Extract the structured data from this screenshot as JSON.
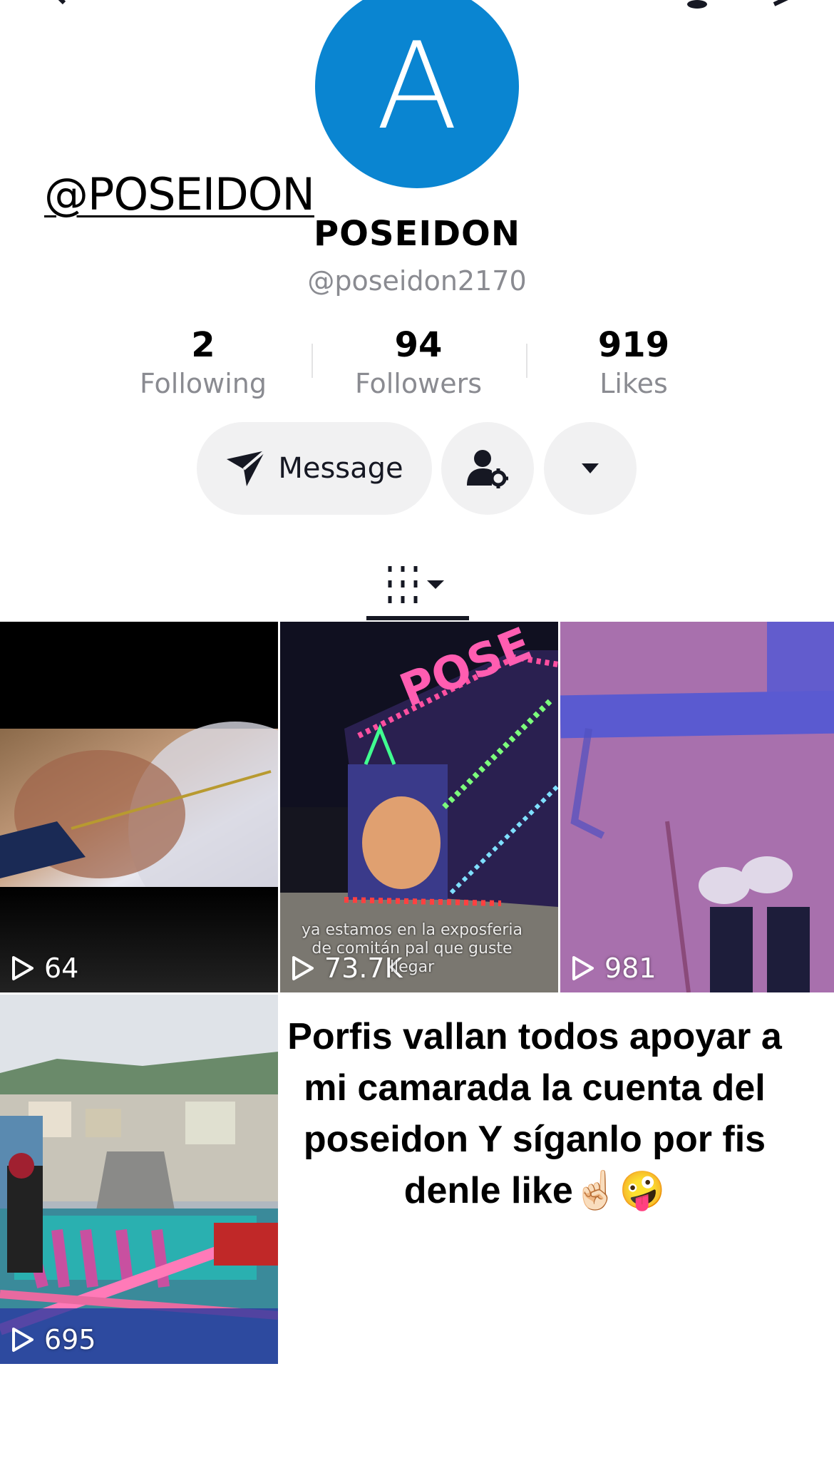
{
  "profile": {
    "avatar_letter": "A",
    "handle_overlay": "@POSEIDON",
    "display_name": "POSEIDON",
    "username": "@poseidon2170",
    "accent_color": "#0a85d1"
  },
  "stats": [
    {
      "value": "2",
      "label": "Following"
    },
    {
      "value": "94",
      "label": "Followers"
    },
    {
      "value": "919",
      "label": "Likes"
    }
  ],
  "actions": {
    "message_label": "Message",
    "icons": [
      "send-icon",
      "person-settings-icon",
      "caret-down-icon"
    ]
  },
  "tabs": {
    "icon": "grid-icon"
  },
  "videos": [
    {
      "views": "64"
    },
    {
      "views": "73.7K",
      "caption": "ya estamos en la exposferia de comitán pal que guste llegar"
    },
    {
      "views": "981"
    },
    {
      "views": "695"
    }
  ],
  "promo_text": "Porfis vallan todos apoyar a mi camarada la cuenta del poseidon Y síganlo por fis denle like☝🏻🤪"
}
